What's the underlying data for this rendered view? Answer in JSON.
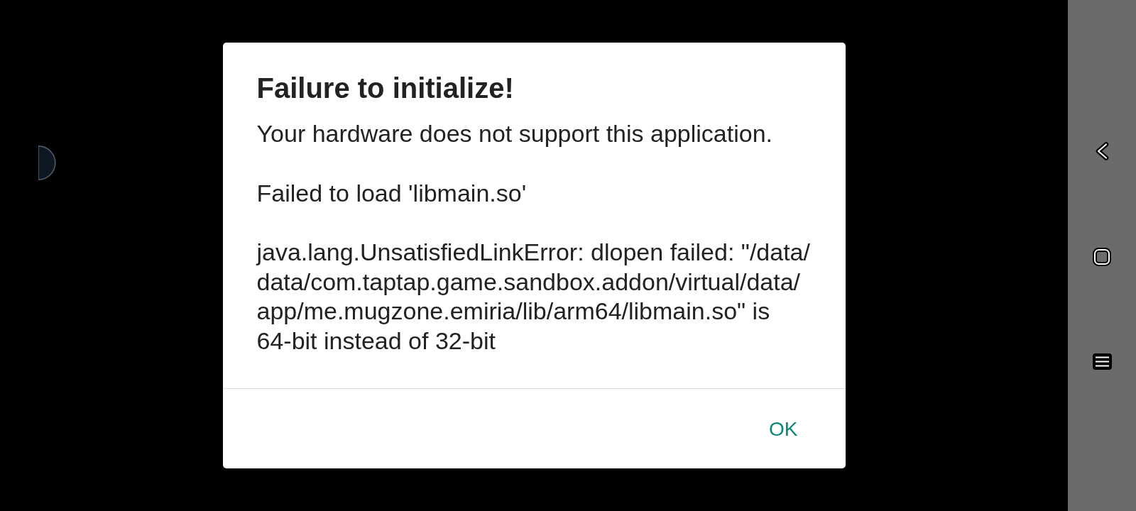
{
  "dialog": {
    "title": "Failure to initialize!",
    "message": [
      "Your hardware does not support this application.",
      "Failed to load 'libmain.so'",
      "java.lang.UnsatisfiedLinkError: dlopen failed: \"/data/data/com.taptap.game.sandbox.addon/virtual/data/app/me.mugzone.emiria/lib/arm64/libmain.so\" is 64-bit instead of 32-bit"
    ],
    "buttons": [
      {
        "label": "OK"
      }
    ]
  }
}
